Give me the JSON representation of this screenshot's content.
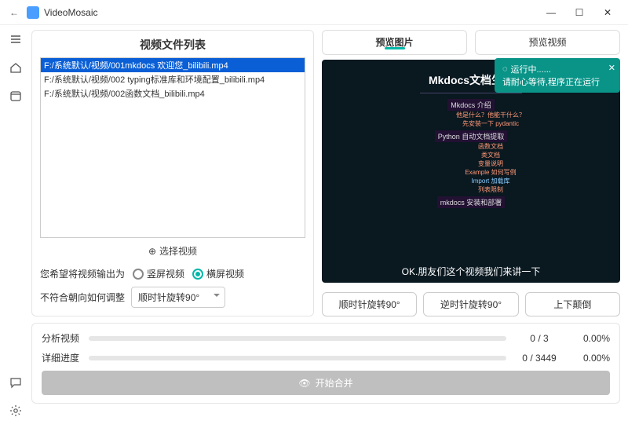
{
  "app": {
    "title": "VideoMosaic"
  },
  "window": {
    "min": "—",
    "max": "☐",
    "close": "✕",
    "back": "←"
  },
  "sidebar": {
    "menu": "≡",
    "home": "⌂",
    "calendar": "📅",
    "chat": "💬",
    "settings": "⚙"
  },
  "left": {
    "title": "视频文件列表",
    "files": [
      "F:/系统默认/视频/001mkdocs 欢迎您_bilibili.mp4",
      "F:/系统默认/视频/002 typing标准库和环境配置_bilibili.mp4",
      "F:/系统默认/视频/002函数文档_bilibili.mp4"
    ],
    "select_btn": "选择视频",
    "orient_label": "您希望将视频输出为",
    "orient_v": "竖屏视频",
    "orient_h": "横屏视频",
    "adjust_label": "不符合朝向如何调整",
    "adjust_value": "顺时针旋转90°"
  },
  "right": {
    "tabs": {
      "img": "预览图片",
      "vid": "预览视频"
    },
    "toast_title": "运行中......",
    "toast_body": "请耐心等待,程序正在运行",
    "preview": {
      "title": "Mkdocs文档生成",
      "sec1": "Mkdocs 介绍",
      "sub1a": "他是什么？他能干什么？",
      "sub1b": "先安装一下 pydantic",
      "sec2": "Python 自动文档提取",
      "sub2a": "函数文档",
      "sub2b": "类文档",
      "sub2c": "变量说明",
      "sub2d": "Example 如何写例",
      "sub2e": "Import 加载库",
      "sub2f": "列表限制",
      "sec3": "mkdocs 安装和部署",
      "bottom": "OK.朋友们这个视频我们来讲一下"
    },
    "rot_cw": "顺时针旋转90°",
    "rot_ccw": "逆时针旋转90°",
    "flip": "上下颠倒"
  },
  "progress": {
    "analyze": "分析视频",
    "detail": "详细进度",
    "a_cur": "0",
    "a_tot": "3",
    "a_pct": "0.00%",
    "d_cur": "0",
    "d_tot": "3449",
    "d_pct": "0.00%",
    "start": "开始合并"
  }
}
